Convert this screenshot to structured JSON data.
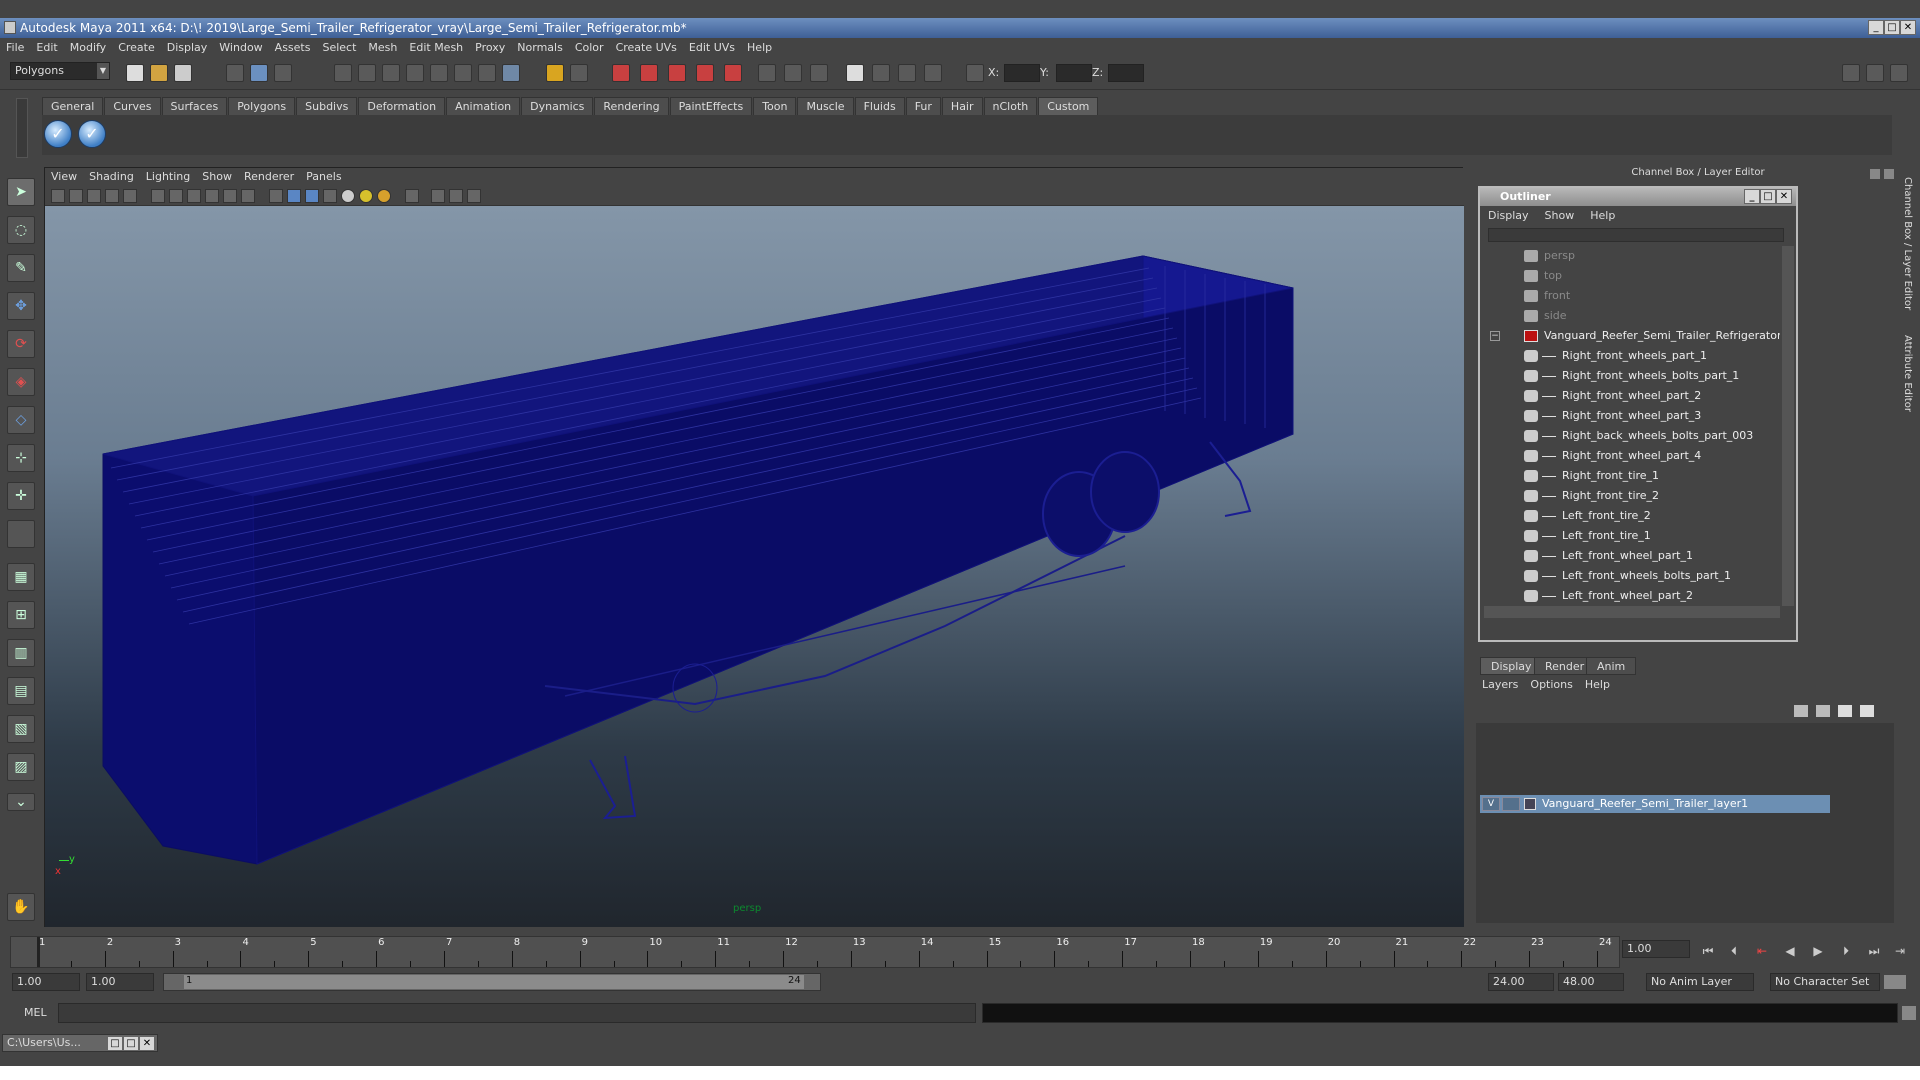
{
  "window": {
    "title": "Autodesk Maya 2011 x64: D:\\! 2019\\Large_Semi_Trailer_Refrigerator_vray\\Large_Semi_Trailer_Refrigerator.mb*"
  },
  "menubar": [
    "File",
    "Edit",
    "Modify",
    "Create",
    "Display",
    "Window",
    "Assets",
    "Select",
    "Mesh",
    "Edit Mesh",
    "Proxy",
    "Normals",
    "Color",
    "Create UVs",
    "Edit UVs",
    "Help"
  ],
  "status": {
    "mode": "Polygons",
    "x_label": "X:",
    "y_label": "Y:",
    "z_label": "Z:"
  },
  "shelf_tabs": [
    "General",
    "Curves",
    "Surfaces",
    "Polygons",
    "Subdivs",
    "Deformation",
    "Animation",
    "Dynamics",
    "Rendering",
    "PaintEffects",
    "Toon",
    "Muscle",
    "Fluids",
    "Fur",
    "Hair",
    "nCloth",
    "Custom"
  ],
  "shelf_active": "Custom",
  "viewport": {
    "menu": [
      "View",
      "Shading",
      "Lighting",
      "Show",
      "Renderer",
      "Panels"
    ],
    "camera": "persp",
    "axis_x": "x",
    "axis_y": "y"
  },
  "channel_box_title": "Channel Box / Layer Editor",
  "outliner": {
    "title": "Outliner",
    "menu": [
      "Display",
      "Show",
      "Help"
    ],
    "items": [
      {
        "label": "persp",
        "type": "camera",
        "dim": true
      },
      {
        "label": "top",
        "type": "camera",
        "dim": true
      },
      {
        "label": "front",
        "type": "camera",
        "dim": true
      },
      {
        "label": "side",
        "type": "camera",
        "dim": true
      },
      {
        "label": "Vanguard_Reefer_Semi_Trailer_Refrigerator",
        "type": "group",
        "dim": false
      },
      {
        "label": "Right_front_wheels_part_1",
        "type": "mesh",
        "dim": false
      },
      {
        "label": "Right_front_wheels_bolts_part_1",
        "type": "mesh",
        "dim": false
      },
      {
        "label": "Right_front_wheel_part_2",
        "type": "mesh",
        "dim": false
      },
      {
        "label": "Right_front_wheel_part_3",
        "type": "mesh",
        "dim": false
      },
      {
        "label": "Right_back_wheels_bolts_part_003",
        "type": "mesh",
        "dim": false
      },
      {
        "label": "Right_front_wheel_part_4",
        "type": "mesh",
        "dim": false
      },
      {
        "label": "Right_front_tire_1",
        "type": "mesh",
        "dim": false
      },
      {
        "label": "Right_front_tire_2",
        "type": "mesh",
        "dim": false
      },
      {
        "label": "Left_front_tire_2",
        "type": "mesh",
        "dim": false
      },
      {
        "label": "Left_front_tire_1",
        "type": "mesh",
        "dim": false
      },
      {
        "label": "Left_front_wheel_part_1",
        "type": "mesh",
        "dim": false
      },
      {
        "label": "Left_front_wheels_bolts_part_1",
        "type": "mesh",
        "dim": false
      },
      {
        "label": "Left_front_wheel_part_2",
        "type": "mesh",
        "dim": false
      }
    ]
  },
  "layer_editor": {
    "tabs": [
      "Display",
      "Render",
      "Anim"
    ],
    "menu": [
      "Layers",
      "Options",
      "Help"
    ],
    "layer_visible": "V",
    "layer_name": "Vanguard_Reefer_Semi_Trailer_layer1"
  },
  "side_tabs": [
    "Channel Box / Layer Editor",
    "Attribute Editor"
  ],
  "timeline": {
    "ticks": [
      "1",
      "2",
      "3",
      "4",
      "5",
      "6",
      "7",
      "8",
      "9",
      "10",
      "11",
      "12",
      "13",
      "14",
      "15",
      "16",
      "17",
      "18",
      "19",
      "20",
      "21",
      "22",
      "23",
      "24"
    ],
    "current_frame": "1.00"
  },
  "range": {
    "start": "1.00",
    "start2": "1.00",
    "slider_start": "1",
    "slider_end": "24",
    "end": "24.00",
    "end2": "48.00",
    "anim_layer": "No Anim Layer",
    "char_set": "No Character Set"
  },
  "cmdline": {
    "label": "MEL"
  },
  "taskbar": {
    "item": "C:\\Users\\Us..."
  }
}
